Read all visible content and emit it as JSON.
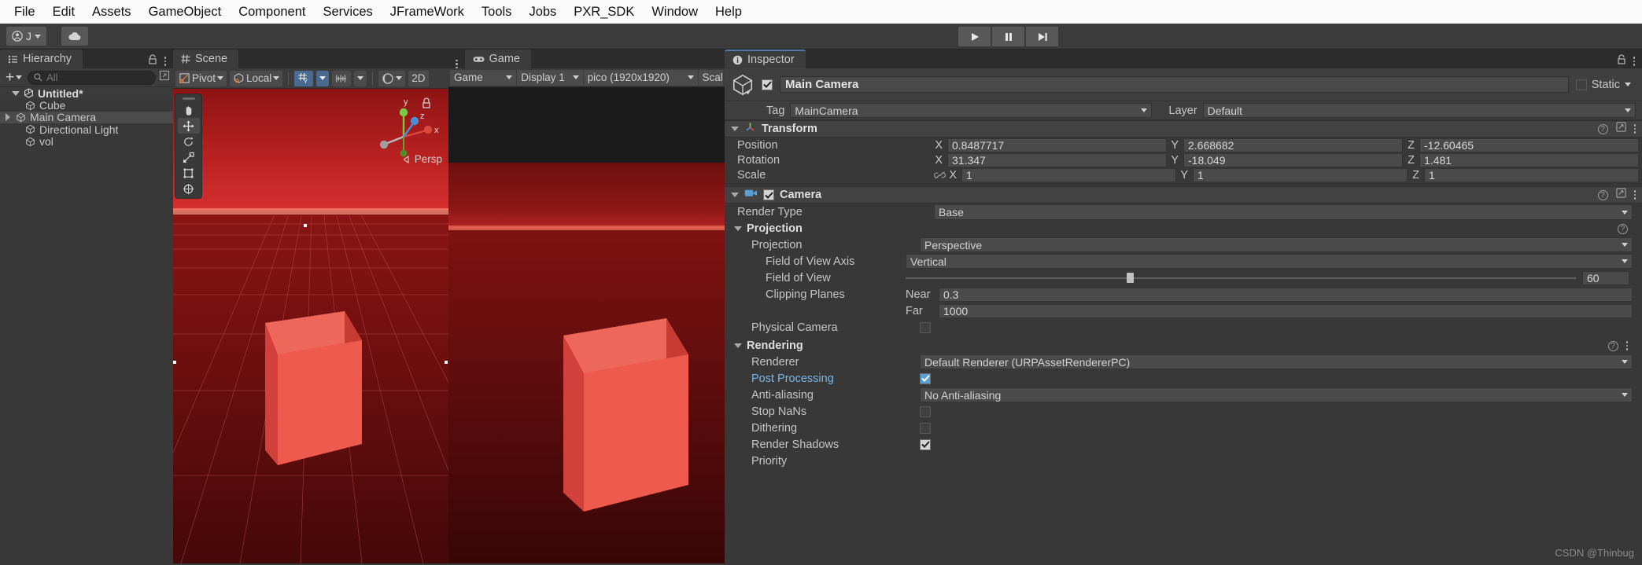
{
  "menubar": {
    "items": [
      "File",
      "Edit",
      "Assets",
      "GameObject",
      "Component",
      "Services",
      "JFrameWork",
      "Tools",
      "Jobs",
      "PXR_SDK",
      "Window",
      "Help"
    ]
  },
  "toolbar": {
    "account_label": "J",
    "play_icon": "play-icon",
    "pause_icon": "pause-icon",
    "step_icon": "step-icon"
  },
  "hierarchy": {
    "tab_label": "Hierarchy",
    "tab_icon": "hierarchy-icon",
    "add_label": "+",
    "search_placeholder": "All",
    "items": [
      {
        "label": "Untitled*",
        "depth": 0,
        "expanded": true,
        "selected": false,
        "icon": "unity-scene-icon"
      },
      {
        "label": "Cube",
        "depth": 1,
        "expanded": false,
        "selected": false,
        "icon": "gameobject-icon"
      },
      {
        "label": "Main Camera",
        "depth": 1,
        "expanded": false,
        "selected": true,
        "icon": "gameobject-icon"
      },
      {
        "label": "Directional Light",
        "depth": 1,
        "expanded": false,
        "selected": false,
        "icon": "gameobject-icon"
      },
      {
        "label": "vol",
        "depth": 1,
        "expanded": false,
        "selected": false,
        "icon": "gameobject-icon"
      }
    ]
  },
  "scene": {
    "tab_label": "Scene",
    "tab_icon": "scene-grid-icon",
    "toolbar": {
      "pivot_label": "Pivot",
      "local_label": "Local",
      "grid_icon": "grid-axis-icon",
      "snap_icon": "snap-increment-icon",
      "audio_icon": "audio-icon",
      "lighting_icon": "lighting-sphere-icon",
      "twod_label": "2D"
    },
    "gizmo": {
      "x_label": "x",
      "y_label": "y",
      "z_label": "z",
      "lock_icon": "lock-icon",
      "persp_label": "Persp"
    },
    "tools": [
      "hand-tool",
      "move-tool",
      "rotate-tool",
      "scale-tool",
      "rect-tool",
      "transform-tool"
    ]
  },
  "game": {
    "tab_label": "Game",
    "tab_icon": "gamepad-icon",
    "toolbar": {
      "display_mode": "Game",
      "display_target": "Display 1",
      "resolution": "pico (1920x1920)",
      "scale_label": "Scale"
    }
  },
  "inspector": {
    "tab_label": "Inspector",
    "tab_icon": "info-icon",
    "object": {
      "enabled": true,
      "name": "Main Camera",
      "icon": "gameobject-icon",
      "static_label": "Static",
      "static_checked": false,
      "tag_label": "Tag",
      "tag_value": "MainCamera",
      "layer_label": "Layer",
      "layer_value": "Default"
    },
    "transform": {
      "title": "Transform",
      "icon": "transform-axis-icon",
      "position_label": "Position",
      "position": {
        "x": "0.8487717",
        "y": "2.668682",
        "z": "-12.60465"
      },
      "rotation_label": "Rotation",
      "rotation": {
        "x": "31.347",
        "y": "-18.049",
        "z": "1.481"
      },
      "scale_label": "Scale",
      "scale": {
        "x": "1",
        "y": "1",
        "z": "1"
      },
      "scale_link_icon": "link-off-icon",
      "axis_x": "X",
      "axis_y": "Y",
      "axis_z": "Z"
    },
    "camera": {
      "title": "Camera",
      "icon": "camera-icon",
      "enabled": true,
      "render_type_label": "Render Type",
      "render_type_value": "Base",
      "projection_group": "Projection",
      "projection_label": "Projection",
      "projection_value": "Perspective",
      "fov_axis_label": "Field of View Axis",
      "fov_axis_value": "Vertical",
      "fov_label": "Field of View",
      "fov_value": "60",
      "fov_percent": 33,
      "clipping_label": "Clipping Planes",
      "near_label": "Near",
      "near_value": "0.3",
      "far_label": "Far",
      "far_value": "1000",
      "physical_camera_label": "Physical Camera",
      "physical_camera_checked": false
    },
    "rendering": {
      "title": "Rendering",
      "renderer_label": "Renderer",
      "renderer_value": "Default Renderer (URPAssetRendererPC)",
      "post_processing_label": "Post Processing",
      "post_processing_checked": true,
      "anti_aliasing_label": "Anti-aliasing",
      "anti_aliasing_value": "No Anti-aliasing",
      "stop_nans_label": "Stop NaNs",
      "stop_nans_checked": false,
      "dithering_label": "Dithering",
      "dithering_checked": false,
      "render_shadows_label": "Render Shadows",
      "render_shadows_checked": true,
      "priority_label": "Priority"
    }
  },
  "watermark": "CSDN @Thinbug"
}
